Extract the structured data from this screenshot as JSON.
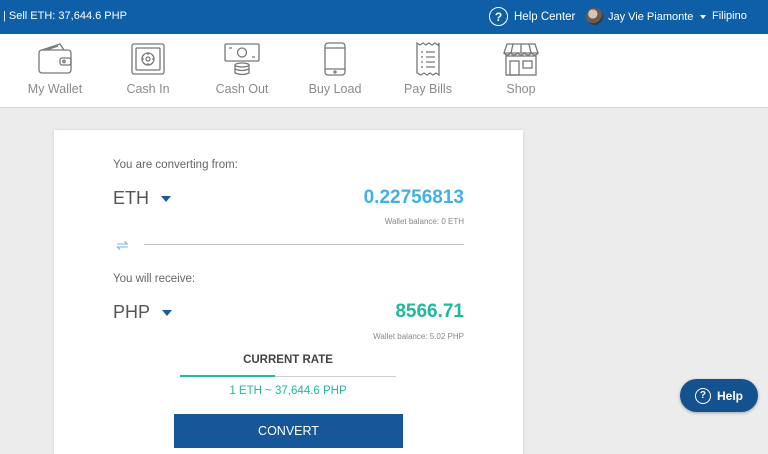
{
  "topbar": {
    "ticker": "| Sell ETH: 37,644.6 PHP",
    "help_label": "Help Center",
    "help_icon_glyph": "?",
    "user_name": "Jay Vie Piamonte",
    "language": "Filipino",
    "color": "#0f5fa8"
  },
  "nav": {
    "items": [
      {
        "label": "My Wallet",
        "icon": "wallet-icon"
      },
      {
        "label": "Cash In",
        "icon": "safe-icon"
      },
      {
        "label": "Cash Out",
        "icon": "cash-out-icon"
      },
      {
        "label": "Buy Load",
        "icon": "phone-icon"
      },
      {
        "label": "Pay Bills",
        "icon": "receipt-icon"
      },
      {
        "label": "Shop",
        "icon": "store-icon"
      }
    ]
  },
  "converter": {
    "from_label": "You are converting from:",
    "from_currency": "ETH",
    "from_amount": "0.22756813",
    "from_balance": "Wallet balance: 0 ETH",
    "swap_glyph": "⇌",
    "to_label": "You will receive:",
    "to_currency": "PHP",
    "to_amount": "8566.71",
    "to_balance": "Wallet balance: 5.02 PHP",
    "rate_title": "CURRENT RATE",
    "rate_progress": 0.44,
    "rate_value": "1 ETH ~ 37,644.6 PHP",
    "convert_label": "CONVERT",
    "colors": {
      "eth_amount": "#3fb0e8",
      "php_amount": "#22b89b",
      "button": "#155798"
    }
  },
  "fab": {
    "label": "Help",
    "icon_glyph": "?"
  }
}
